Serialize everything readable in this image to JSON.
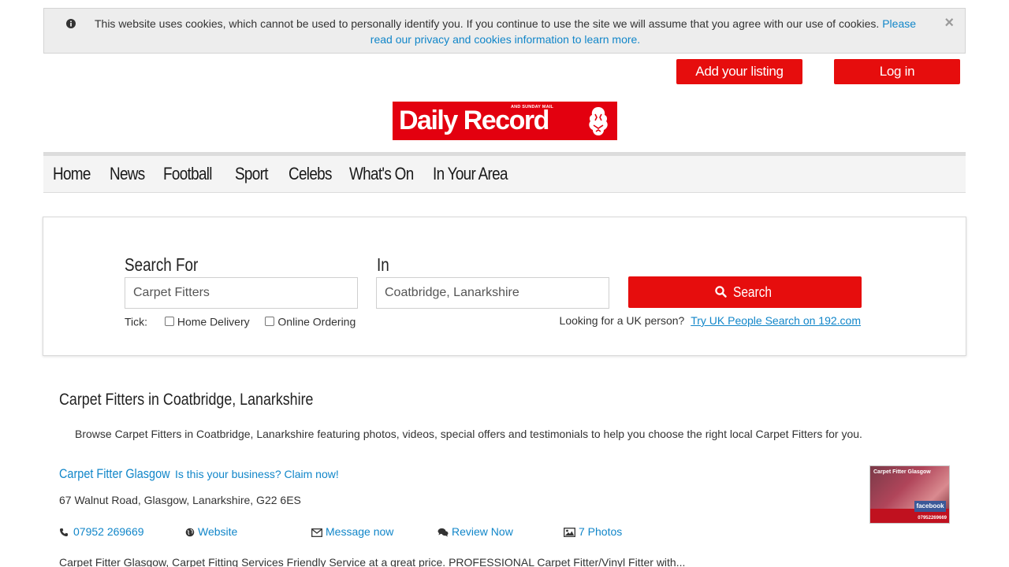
{
  "cookie_banner": {
    "message": "This website uses cookies, which cannot be used to personally identify you. If you continue to use the site we will assume that you agree with our use of cookies.",
    "link_text": "Please read our privacy and cookies information to learn more.",
    "close_label": "×"
  },
  "header": {
    "add_listing_label": "Add your listing",
    "login_label": "Log in",
    "logo_text": "Daily Record",
    "logo_subtext": "AND SUNDAY MAIL"
  },
  "nav": {
    "items": [
      {
        "label": "Home"
      },
      {
        "label": "News"
      },
      {
        "label": "Football"
      },
      {
        "label": "Sport"
      },
      {
        "label": "Celebs"
      },
      {
        "label": "What's On"
      },
      {
        "label": "In Your Area"
      }
    ]
  },
  "search": {
    "search_for_label": "Search For",
    "search_for_value": "Carpet Fitters",
    "in_label": "In",
    "in_value": "Coatbridge, Lanarkshire",
    "button_label": "Search",
    "tick_label": "Tick:",
    "home_delivery_label": "Home Delivery",
    "online_ordering_label": "Online Ordering",
    "uk_person_text": "Looking for a UK person?",
    "uk_person_link": "Try UK People Search on 192.com"
  },
  "results": {
    "title": "Carpet Fitters in Coatbridge, Lanarkshire",
    "description": "Browse Carpet Fitters in Coatbridge, Lanarkshire featuring photos, videos, special offers and testimonials to help you choose the right local Carpet Fitters for you.",
    "listings": [
      {
        "name": "Carpet Fitter Glasgow",
        "claim_text": "Is this your business? Claim now!",
        "address": "67 Walnut Road, Glasgow, Lanarkshire, G22 6ES",
        "phone": "07952 269669",
        "website_label": "Website",
        "message_label": "Message now",
        "review_label": "Review Now",
        "photos_label": "7 Photos",
        "thumb_title": "Carpet Fitter Glasgow",
        "thumb_phone": "07952269669",
        "thumb_fb": "facebook",
        "snippet": "Carpet Fitter Glasgow, Carpet Fitting Services Friendly Service at a great price. PROFESSIONAL Carpet Fitter/Vinyl Fitter with..."
      }
    ]
  },
  "colors": {
    "brand_red": "#e60d0d",
    "link_blue": "#1186c9"
  }
}
